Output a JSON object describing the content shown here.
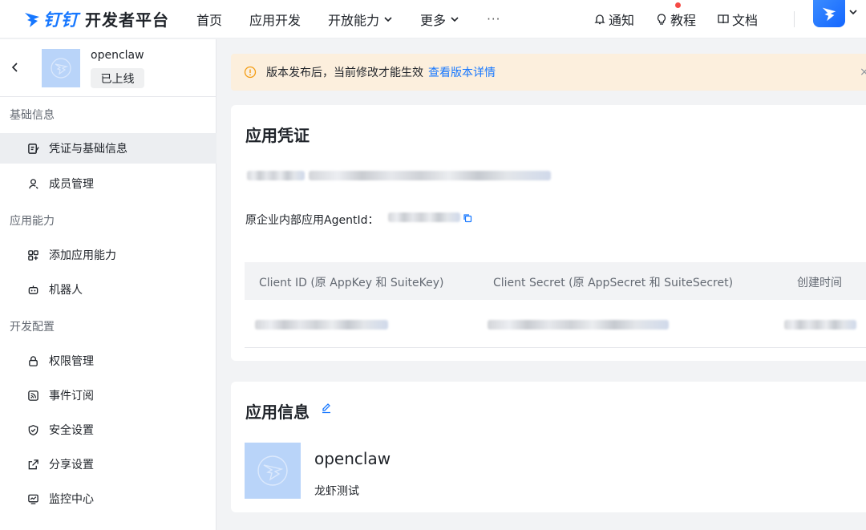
{
  "brand": {
    "ding": "钉钉",
    "platform": "开发者平台"
  },
  "nav": {
    "items": [
      "首页",
      "应用开发",
      "开放能力",
      "更多"
    ],
    "more": "···",
    "notify": "通知",
    "tutorial": "教程",
    "docs": "文档"
  },
  "sidebar": {
    "app_name": "openclaw",
    "app_status": "已上线",
    "sections": [
      "基础信息",
      "应用能力",
      "开发配置"
    ],
    "items": [
      "凭证与基础信息",
      "成员管理",
      "添加应用能力",
      "机器人",
      "权限管理",
      "事件订阅",
      "安全设置",
      "分享设置",
      "监控中心"
    ],
    "active_index": 0
  },
  "banner": {
    "text": "版本发布后，当前修改才能生效",
    "link": "查看版本详情",
    "close": "×"
  },
  "credentials": {
    "title": "应用凭证",
    "agent_label": "原企业内部应用AgentId：",
    "columns": [
      "Client ID (原 AppKey 和 SuiteKey)",
      "Client Secret (原 AppSecret 和 SuiteSecret)",
      "创建时间"
    ]
  },
  "app_info": {
    "title": "应用信息",
    "name": "openclaw",
    "desc": "龙虾测试"
  },
  "colors": {
    "accent": "#1677ff",
    "banner_bg": "#fcefdd",
    "warn": "#f39c12"
  }
}
